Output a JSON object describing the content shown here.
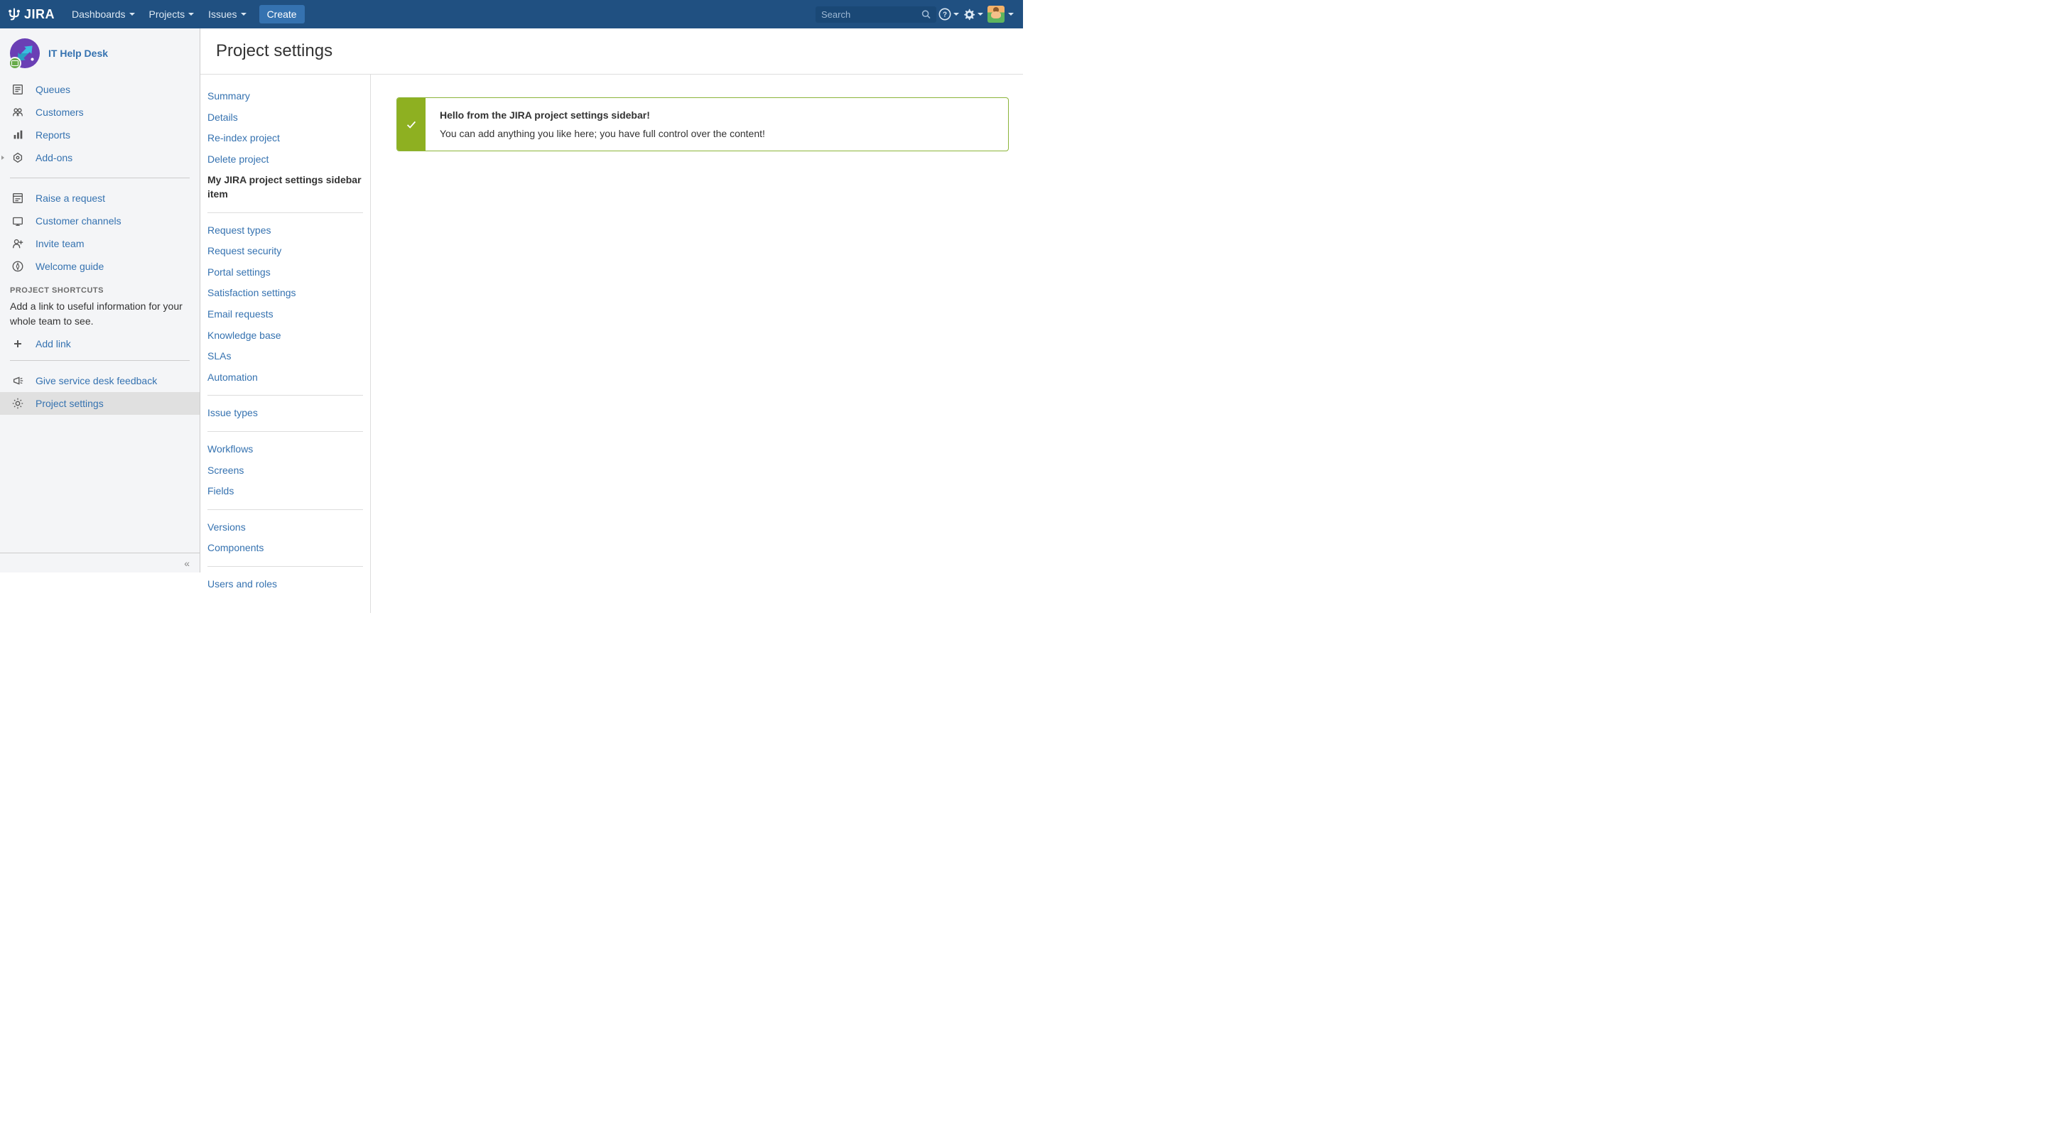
{
  "topnav": {
    "dashboards": "Dashboards",
    "projects": "Projects",
    "issues": "Issues",
    "create": "Create",
    "search_placeholder": "Search"
  },
  "project": {
    "name": "IT Help Desk"
  },
  "sidebar": {
    "items": [
      {
        "label": "Queues"
      },
      {
        "label": "Customers"
      },
      {
        "label": "Reports"
      },
      {
        "label": "Add-ons"
      }
    ],
    "items2": [
      {
        "label": "Raise a request"
      },
      {
        "label": "Customer channels"
      },
      {
        "label": "Invite team"
      },
      {
        "label": "Welcome guide"
      }
    ],
    "shortcuts_heading": "PROJECT SHORTCUTS",
    "shortcuts_text": "Add a link to useful information for your whole team to see.",
    "add_link": "Add link",
    "items3": [
      {
        "label": "Give service desk feedback"
      },
      {
        "label": "Project settings"
      }
    ]
  },
  "page": {
    "title": "Project settings"
  },
  "settings_groups": [
    [
      {
        "label": "Summary",
        "active": false
      },
      {
        "label": "Details",
        "active": false
      },
      {
        "label": "Re-index project",
        "active": false
      },
      {
        "label": "Delete project",
        "active": false
      },
      {
        "label": "My JIRA project settings sidebar item",
        "active": true
      }
    ],
    [
      {
        "label": "Request types"
      },
      {
        "label": "Request security"
      },
      {
        "label": "Portal settings"
      },
      {
        "label": "Satisfaction settings"
      },
      {
        "label": "Email requests"
      },
      {
        "label": "Knowledge base"
      },
      {
        "label": "SLAs"
      },
      {
        "label": "Automation"
      }
    ],
    [
      {
        "label": "Issue types"
      }
    ],
    [
      {
        "label": "Workflows"
      },
      {
        "label": "Screens"
      },
      {
        "label": "Fields"
      }
    ],
    [
      {
        "label": "Versions"
      },
      {
        "label": "Components"
      }
    ],
    [
      {
        "label": "Users and roles"
      }
    ]
  ],
  "message": {
    "title": "Hello from the JIRA project settings sidebar!",
    "body": "You can add anything you like here; you have full control over the content!"
  },
  "collapse_label": "«"
}
